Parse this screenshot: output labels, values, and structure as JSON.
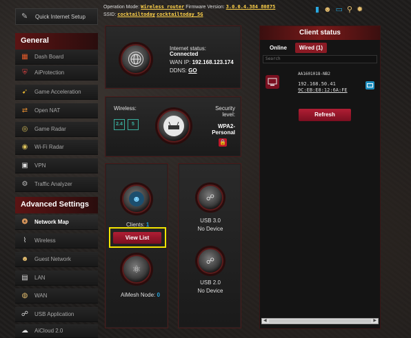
{
  "topbar": {
    "operation_mode_label": "Operation Mode:",
    "operation_mode_value": "Wireless router",
    "firmware_label": "Firmware Version:",
    "firmware_value": "3.0.0.4.384_80875",
    "ssid_label": "SSID:",
    "ssid_1": "cocktailtoday",
    "ssid_2": "cocktailtoday_5G"
  },
  "sidebar": {
    "quick_setup": "Quick Internet Setup",
    "general_title": "General",
    "general_items": [
      {
        "label": "Dash Board",
        "icon": "dashboard-icon"
      },
      {
        "label": "AiProtection",
        "icon": "shield-icon"
      },
      {
        "label": "Game Acceleration",
        "icon": "rocket-icon"
      },
      {
        "label": "Open NAT",
        "icon": "nat-icon"
      },
      {
        "label": "Game Radar",
        "icon": "radar-icon"
      },
      {
        "label": "Wi-Fi Radar",
        "icon": "wifi-radar-icon"
      },
      {
        "label": "VPN",
        "icon": "vpn-icon"
      },
      {
        "label": "Traffic Analyzer",
        "icon": "traffic-icon"
      }
    ],
    "advanced_title": "Advanced Settings",
    "advanced_items": [
      {
        "label": "Network Map",
        "icon": "network-map-icon"
      },
      {
        "label": "Wireless",
        "icon": "wireless-icon"
      },
      {
        "label": "Guest Network",
        "icon": "guest-icon"
      },
      {
        "label": "LAN",
        "icon": "lan-icon"
      },
      {
        "label": "WAN",
        "icon": "wan-icon"
      },
      {
        "label": "USB Application",
        "icon": "usb-app-icon"
      },
      {
        "label": "AiCloud 2.0",
        "icon": "cloud-icon"
      }
    ]
  },
  "internet": {
    "status_label": "Internet status:",
    "status_value": "Connected",
    "wan_ip_label": "WAN IP:",
    "wan_ip_value": "192.168.123.174",
    "ddns_label": "DDNS:",
    "ddns_value": "GO"
  },
  "wireless": {
    "label": "Wireless:",
    "band_24": "2.4",
    "band_5": "5",
    "security_label_1": "Security",
    "security_label_2": "level:",
    "security_value_1": "WPA2-",
    "security_value_2": "Personal"
  },
  "clients": {
    "label": "Clients:",
    "count": "1",
    "view_list": "View List",
    "aimesh_label": "AiMesh Node:",
    "aimesh_count": "0"
  },
  "usb": {
    "usb3_label": "USB 3.0",
    "usb3_status": "No Device",
    "usb2_label": "USB 2.0",
    "usb2_status": "No Device"
  },
  "client_status": {
    "title": "Client status",
    "tab_online": "Online",
    "tab_wired": "Wired (1)",
    "search_placeholder": "Search",
    "client_name": "AA1601018-NB2",
    "client_ip": "192.168.50.41",
    "client_mac": "9C:EB:E8:12:6A:FE",
    "refresh": "Refresh"
  },
  "colors": {
    "accent": "#8a1a24",
    "highlight": "#ffd24a",
    "link_blue": "#29a8e0",
    "callout_yellow": "#f5e500"
  }
}
